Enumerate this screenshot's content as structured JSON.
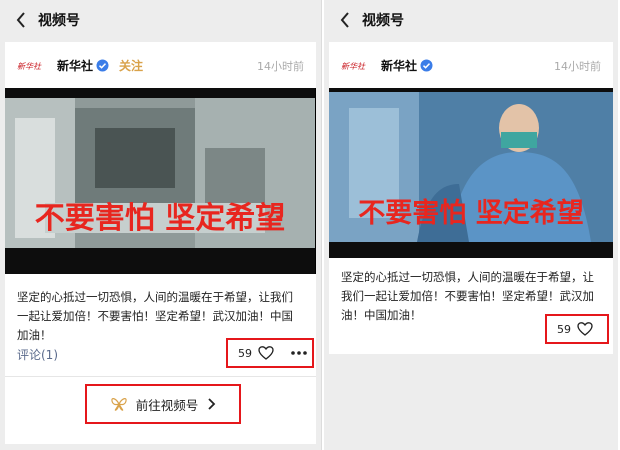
{
  "left": {
    "topbar_title": "视频号",
    "account_name": "新华社",
    "avatar_text": "新华社",
    "follow_label": "关注",
    "time_label": "14小时前",
    "video_overlay": "不要害怕 坚定希望",
    "caption": "坚定的心抵过一切恐惧，人间的温暖在于希望，让我们一起让爱加倍！不要害怕！坚定希望！武汉加油！中国加油！",
    "comment_label": "评论(1)",
    "like_count": "59",
    "goto_label": "前往视频号"
  },
  "right": {
    "topbar_title": "视频号",
    "account_name": "新华社",
    "avatar_text": "新华社",
    "time_label": "14小时前",
    "video_overlay": "不要害怕 坚定希望",
    "caption": "坚定的心抵过一切恐惧，人间的温暖在于希望，让我们一起让爱加倍！不要害怕！坚定希望！武汉加油！中国加油！",
    "like_count": "59"
  },
  "colors": {
    "follow": "#d9a24a",
    "comment_link": "#5b6b8c",
    "highlight_box": "#e5171b",
    "overlay_text": "#e8261f",
    "verified_badge": "#3b7de8"
  },
  "icons": [
    "chevron-left-icon",
    "verified-icon",
    "heart-icon",
    "more-icon",
    "butterfly-icon",
    "chevron-right-icon"
  ]
}
